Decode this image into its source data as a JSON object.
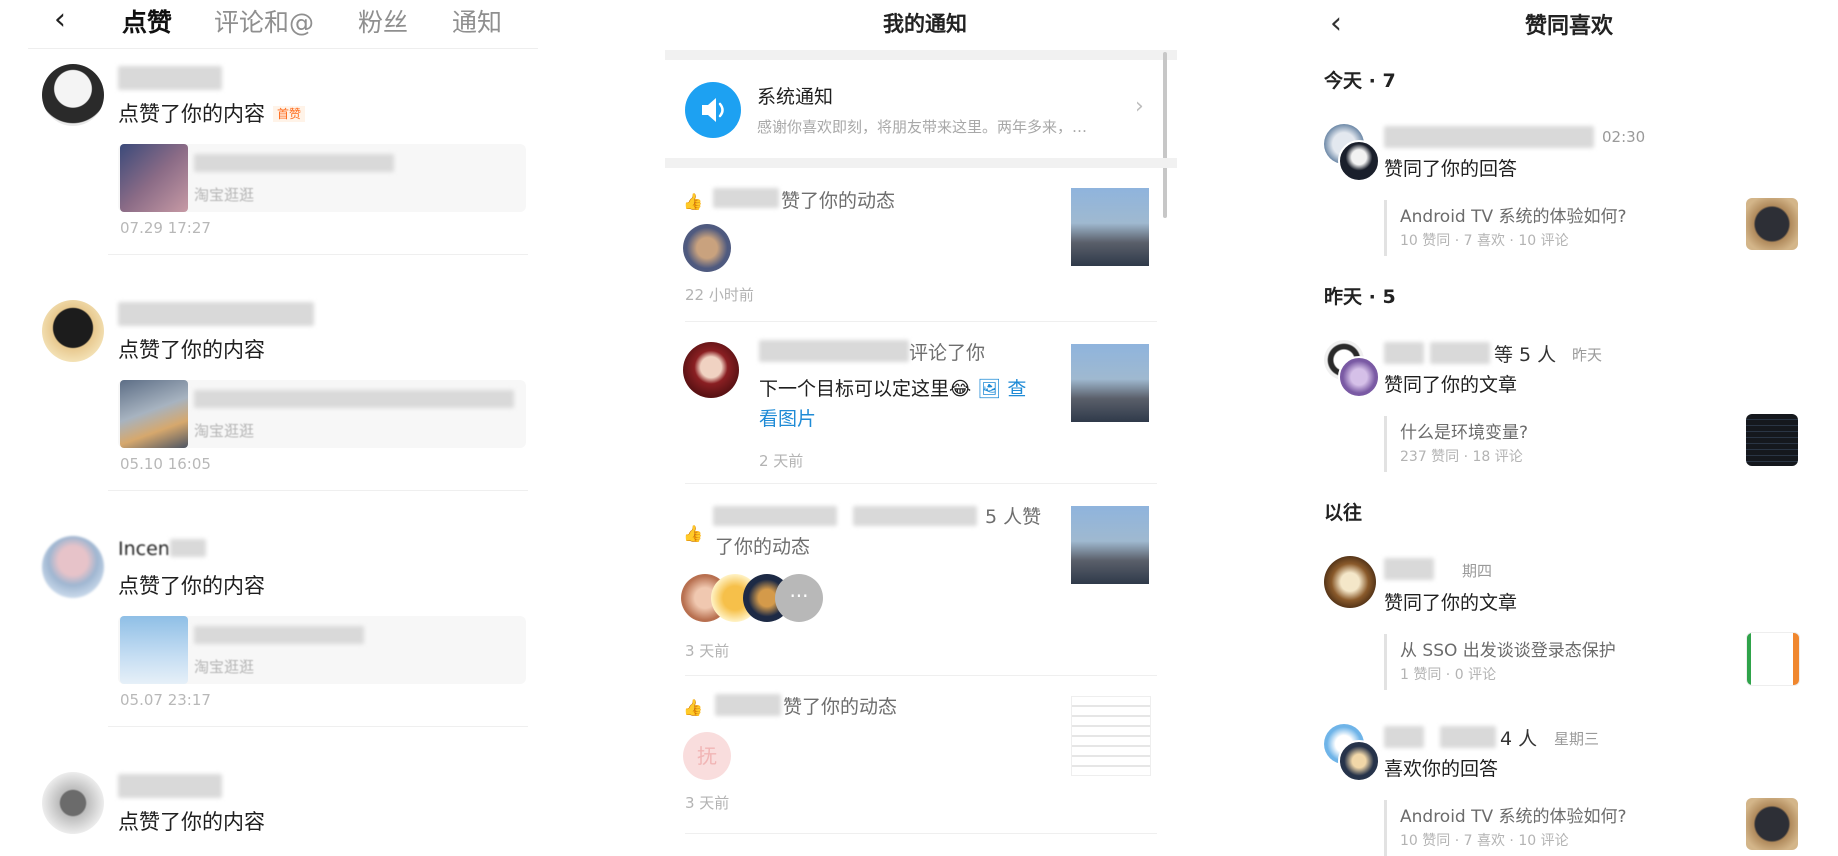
{
  "panel1": {
    "back_icon": "chevron-left-icon",
    "tabs": [
      "点赞",
      "评论和@",
      "粉丝",
      "通知"
    ],
    "items": [
      {
        "action": "点赞了你的内容",
        "badge": "首赞",
        "card_sub": "淘宝逛逛",
        "time": "07.29 17:27"
      },
      {
        "action": "点赞了你的内容",
        "badge": "",
        "card_sub": "淘宝逛逛",
        "time": "05.10 16:05"
      },
      {
        "action": "点赞了你的内容",
        "badge": "",
        "card_sub": "淘宝逛逛",
        "time": "05.07 23:17",
        "name_partial": "Incen"
      },
      {
        "action": "点赞了你的内容",
        "badge": "",
        "card_sub": "",
        "time": ""
      }
    ]
  },
  "panel2": {
    "title": "我的通知",
    "system": {
      "icon": "speaker-icon",
      "title": "系统通知",
      "subtitle": "感谢你喜欢即刻，将朋友带来这里。两年多来，…"
    },
    "notifications": [
      {
        "text": "赞了你的动态",
        "time": "22 小时前"
      },
      {
        "text": "评论了你",
        "comment": "下一个目标可以定这里😂",
        "link_pre": "查",
        "link": "看图片",
        "time": "2 天前"
      },
      {
        "text": "5 人赞",
        "text2": "了你的动态",
        "more": "···",
        "time": "3 天前"
      },
      {
        "text": "赞了你的动态",
        "avatar_char": "抚",
        "time": "3 天前"
      }
    ]
  },
  "panel3": {
    "back_icon": "chevron-left-icon",
    "title": "赞同喜欢",
    "sections": {
      "today": "今天 · 7",
      "yesterday": "昨天 · 5",
      "earlier": "以往"
    },
    "entries": [
      {
        "when": "02:30",
        "action": "赞同了你的回答",
        "q_title": "Android TV 系统的体验如何?",
        "q_stats": "10 赞同 · 7 喜欢 · 10 评论"
      },
      {
        "suffix": "等 5 人",
        "when": "昨天",
        "action": "赞同了你的文章",
        "q_title": "什么是环境变量?",
        "q_stats": "237 赞同 · 18 评论"
      },
      {
        "when": "期四",
        "action": "赞同了你的文章",
        "q_title": "从 SSO 出发谈谈登录态保护",
        "q_stats": "1 赞同 · 0 评论"
      },
      {
        "suffix": "4 人",
        "when": "星期三",
        "action": "喜欢你的回答",
        "q_title": "Android TV 系统的体验如何?",
        "q_stats": "10 赞同 · 7 喜欢 · 10 评论"
      }
    ]
  }
}
